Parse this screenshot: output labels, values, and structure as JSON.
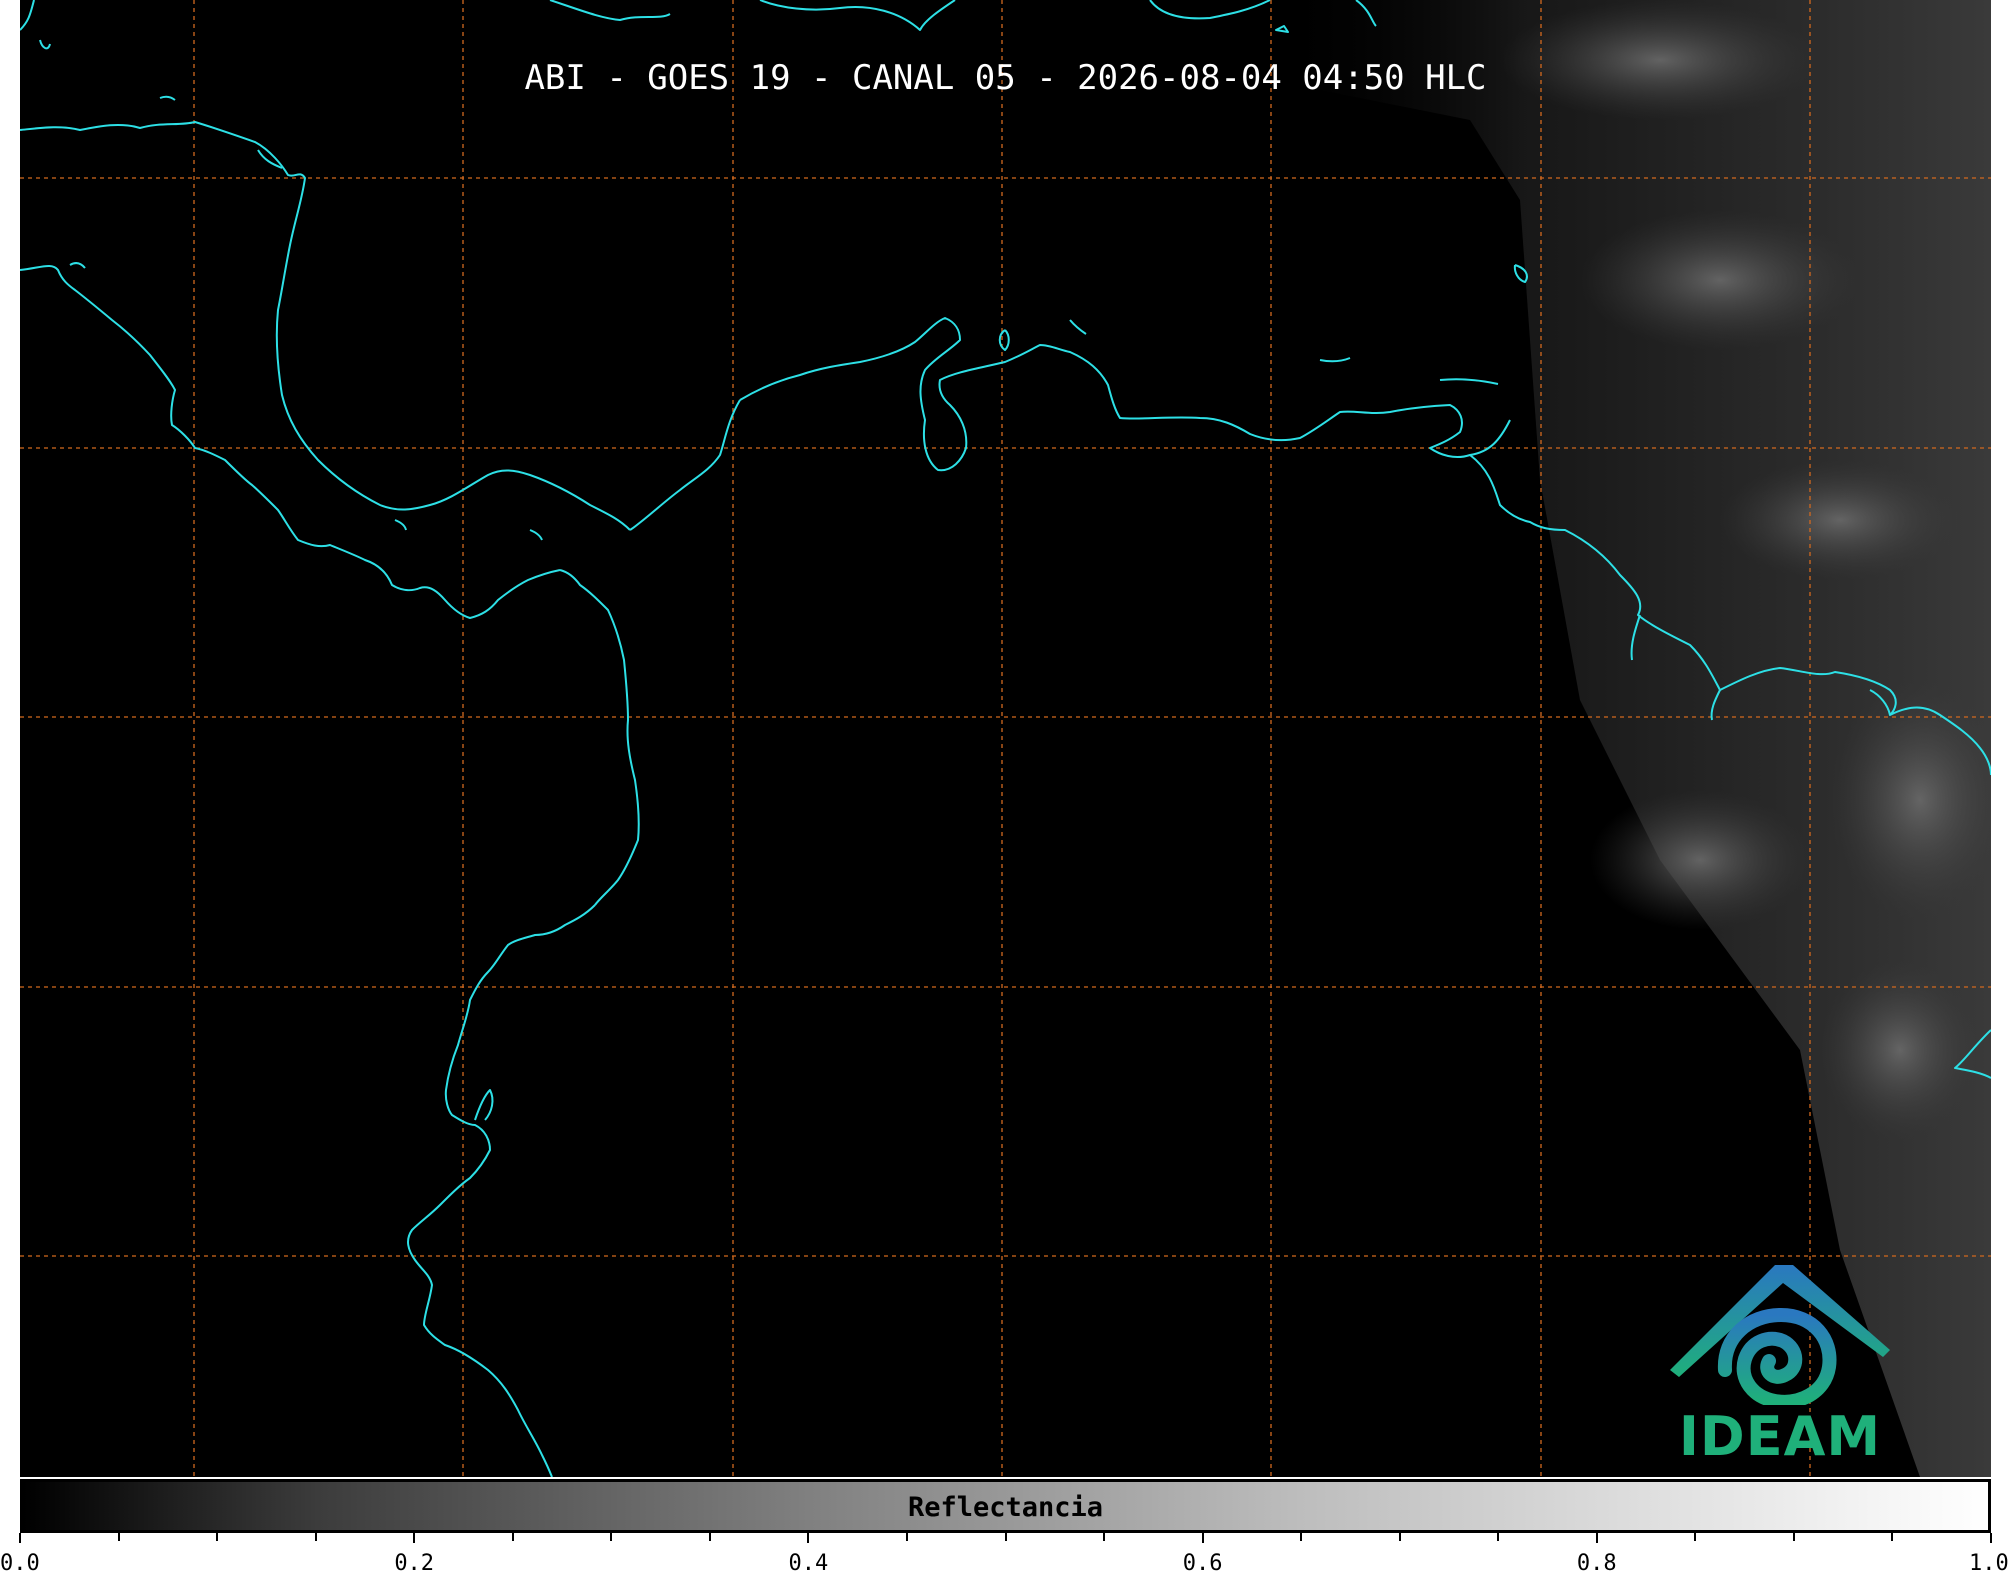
{
  "title": "ABI - GOES 19 - CANAL 05 - 2026-08-04 04:50 HLC",
  "logo": {
    "text": "IDEAM",
    "icon": "ideam-logo-icon"
  },
  "colorbar": {
    "label": "Reflectancia",
    "ticks": [
      "0.0",
      "0.2",
      "0.4",
      "0.6",
      "0.8",
      "1.0"
    ],
    "range": [
      0.0,
      1.0
    ],
    "minor_step": 0.05,
    "colormap": "grayscale"
  },
  "map": {
    "background": "#000000",
    "coastline_color": "#2de0e6",
    "gridline_color": "#d2691e",
    "gridline_style": "dashed",
    "cloud_region": "east"
  }
}
